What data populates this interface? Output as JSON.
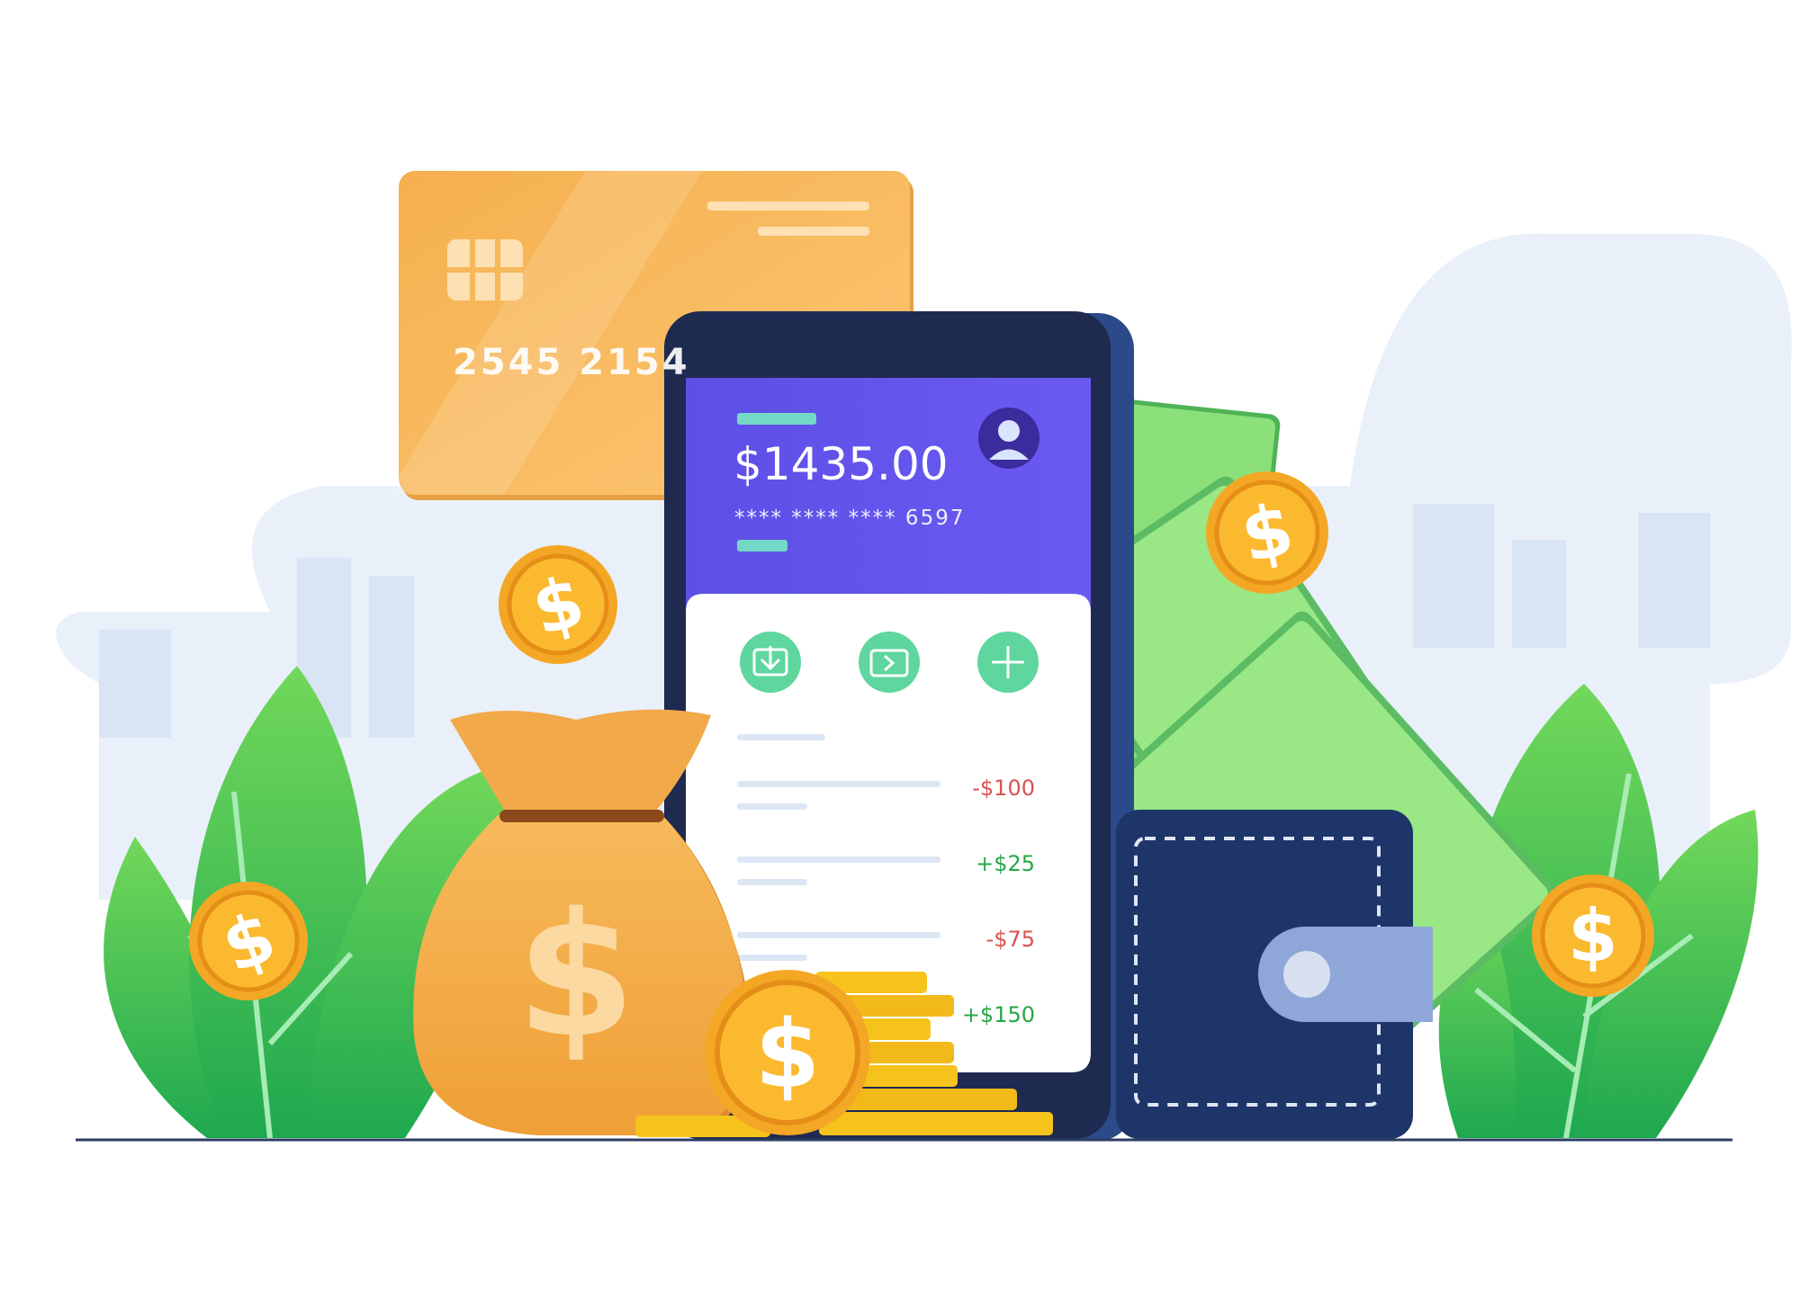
{
  "card": {
    "number": "2545 2154"
  },
  "phone": {
    "balance": "$1435.00",
    "masked_card": "**** **** **** 6597",
    "actions": [
      {
        "name": "receive-icon"
      },
      {
        "name": "send-icon"
      },
      {
        "name": "add-icon"
      }
    ],
    "transactions": [
      {
        "amount": "-$100",
        "kind": "debit"
      },
      {
        "amount": "+$25",
        "kind": "credit"
      },
      {
        "amount": "-$75",
        "kind": "debit"
      },
      {
        "amount": "+$150",
        "kind": "credit"
      }
    ]
  },
  "colors": {
    "card": "#f6b85a",
    "phone_header": "#5b4fe8",
    "phone_body": "#1f2a50",
    "accent_green": "#5ed69e",
    "wallet": "#1e3569",
    "coin": "#f7a928",
    "debit": "#d9534f",
    "credit": "#28a745"
  }
}
